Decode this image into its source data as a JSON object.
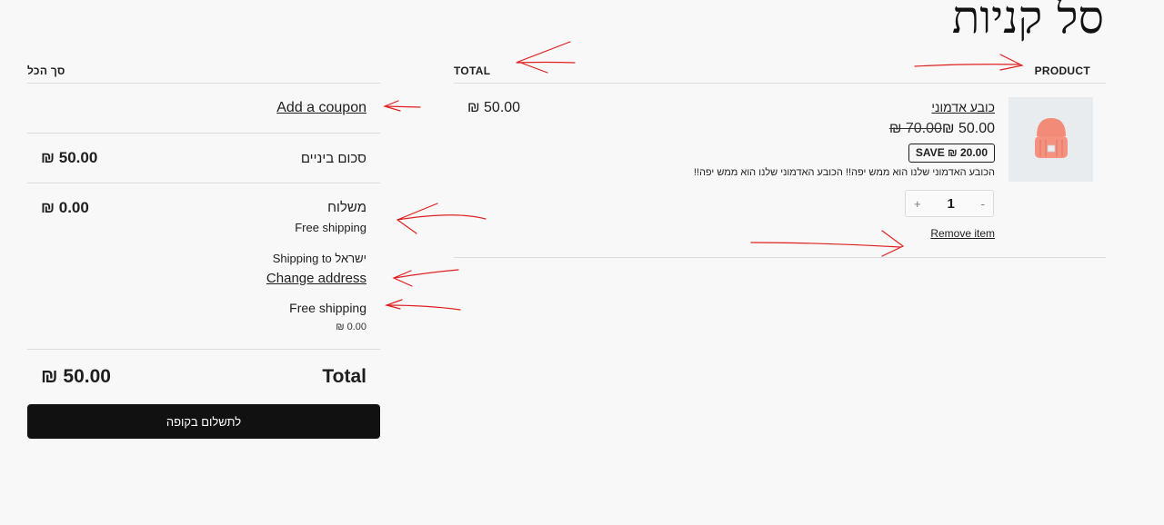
{
  "page": {
    "title": "סל קניות"
  },
  "headers": {
    "product": "PRODUCT",
    "total": "TOTAL",
    "summary": "סך הכל"
  },
  "item": {
    "name": "כובע אדמוני",
    "sale_price": "₪ 50.00",
    "original_price": "₪ 70.00",
    "save_badge": "SAVE ₪ 20.00",
    "description": "הכובע האדמוני שלנו הוא ממש יפה!! הכובע האדמוני שלנו הוא ממש יפה!!",
    "quantity": "1",
    "qty_plus": "+",
    "qty_minus": "-",
    "remove_label": "Remove item",
    "line_total": "₪ 50.00",
    "image_icon": "beanie-hat-icon"
  },
  "summary": {
    "coupon_label": "Add a coupon",
    "subtotal_label": "סכום ביניים",
    "subtotal_value": "₪ 50.00",
    "shipping_label": "משלוח",
    "shipping_value": "₪ 0.00",
    "shipping_method_note": "Free shipping",
    "shipping_to": "Shipping to ישראל",
    "change_address": "Change address",
    "shipping_option": "Free shipping",
    "shipping_option_price": "₪ 0.00",
    "total_label": "Total",
    "total_value": "₪ 50.00",
    "checkout_button": "לתשלום בקופה"
  },
  "colors": {
    "annotation": "#e02020",
    "checkout_bg": "#111111",
    "image_bg": "#e9ecef"
  }
}
